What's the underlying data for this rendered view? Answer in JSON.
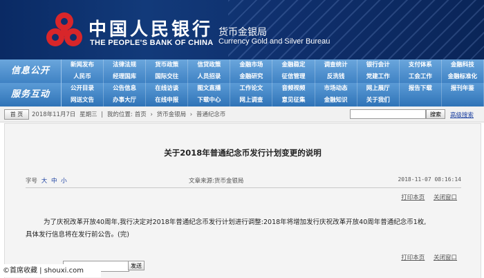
{
  "header": {
    "bank_name_cn": "中国人民银行",
    "bank_name_en": "THE PEOPLE'S BANK OF CHINA",
    "bureau_cn": "货币金银局",
    "bureau_en": "Currency Gold and Silver Bureau"
  },
  "nav": {
    "row1_label": "信息公开",
    "row1_items": [
      "新闻发布",
      "法律法规",
      "货币政策",
      "信贷政策",
      "金融市场",
      "金融稳定",
      "调查统计",
      "银行会计",
      "支付体系",
      "金融科技",
      "人民币",
      "经理国库",
      "国际交往",
      "人员招录",
      "金融研究",
      "征信管理",
      "反洗钱",
      "党建工作",
      "工会工作",
      "金融标准化"
    ],
    "row2_label": "服务互动",
    "row2_items": [
      "公开目录",
      "公告信息",
      "在线访谈",
      "图文直播",
      "工作论文",
      "音频视频",
      "市场动态",
      "网上展厅",
      "报告下载",
      "报刊年鉴",
      "网送文告",
      "办事大厅",
      "在线申报",
      "下载中心",
      "网上调查",
      "意见征集",
      "金融知识",
      "关于我们",
      "",
      ""
    ]
  },
  "utility": {
    "home_label": "首 页",
    "date": "2018年11月7日",
    "weekday": "星期三",
    "location_label": "我的位置:",
    "crumb_home": "首页",
    "crumb_bureau": "货币金银局",
    "crumb_page": "普通纪念币",
    "search_value": "",
    "search_label": "搜索",
    "advanced_search": "高级搜索"
  },
  "article": {
    "title": "关于2018年普通纪念币发行计划变更的说明",
    "font_size_label": "字号",
    "font_large": "大",
    "font_medium": "中",
    "font_small": "小",
    "source": "文章来源:货币金银局",
    "datetime": "2018-11-07  08:16:14",
    "print_label": "打印本页",
    "close_label": "关闭窗口",
    "paragraph1": "为了庆祝改革开放40周年,我行决定对2018年普通纪念币发行计划进行调整:2018年将增加发行庆祝改革开放40周年普通纪念币1枚,",
    "paragraph2": "具体发行信息将在发行前公告。(完)",
    "bottom_button": "发送",
    "bottom_input_value": ""
  },
  "watermark": "©首席收藏 | shouxi.com",
  "colors": {
    "banner": "#0f2f6c",
    "nav_row1": "#3f82c4",
    "nav_row2": "#2f73b7",
    "emblem": "#d8262a",
    "link": "#1a3fa0"
  }
}
